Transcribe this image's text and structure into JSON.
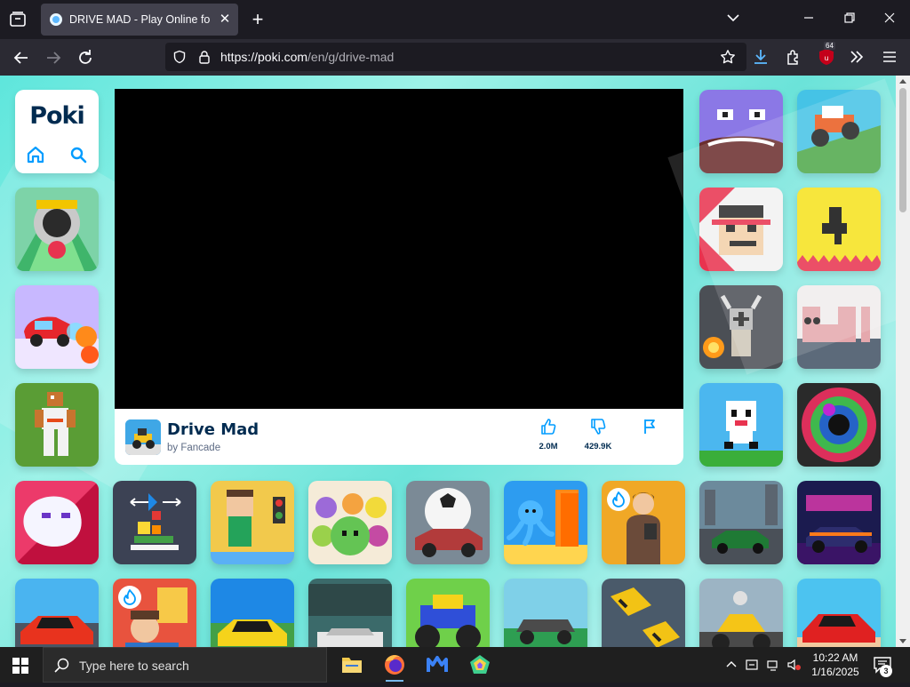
{
  "browser": {
    "tab_title": "DRIVE MAD - Play Online for Free",
    "url_host": "https://poki.com",
    "url_path": "/en/g/drive-mad",
    "extension_badge": "64"
  },
  "site": {
    "logo_text": "Poki"
  },
  "game": {
    "title": "Drive Mad",
    "author": "by Fancade",
    "likes": "2.0M",
    "dislikes": "429.9K"
  },
  "taskbar": {
    "search_placeholder": "Type here to search",
    "time": "10:22 AM",
    "date": "1/16/2025",
    "notification_count": "3"
  },
  "icons": [
    "tab-list-icon",
    "close-icon",
    "plus-icon",
    "chevron-down-icon",
    "minimize-icon",
    "restore-icon",
    "back-arrow-icon",
    "forward-arrow-icon",
    "reload-icon",
    "shield-icon",
    "lock-icon",
    "star-icon",
    "download-icon",
    "extensions-icon",
    "overflow-icon",
    "menu-icon",
    "home-icon",
    "search-icon",
    "thumbs-up-icon",
    "thumbs-down-icon",
    "flag-icon",
    "fire-icon",
    "windows-logo-icon"
  ]
}
